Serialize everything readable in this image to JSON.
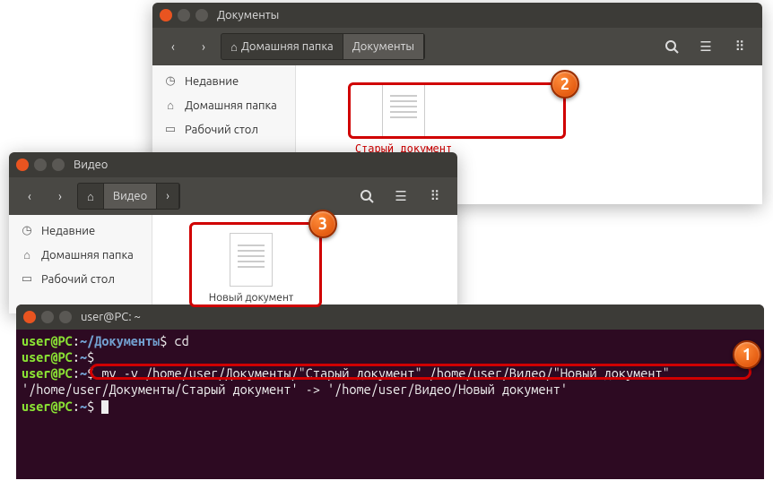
{
  "window1": {
    "title": "Документы",
    "breadcrumb": {
      "home_label": "Домашняя папка",
      "current": "Документы"
    },
    "sidebar": {
      "recent": "Недавние",
      "home": "Домашняя папка",
      "desktop": "Рабочий стол"
    },
    "file": {
      "name": "Старый документ"
    }
  },
  "window2": {
    "title": "Видео",
    "breadcrumb": {
      "current": "Видео"
    },
    "sidebar": {
      "recent": "Недавние",
      "home": "Домашняя папка",
      "desktop": "Рабочий стол"
    },
    "file": {
      "name": "Новый документ"
    }
  },
  "terminal": {
    "title": "user@PC: ~",
    "lines": {
      "l1_user": "user@PC",
      "l1_colon": ":",
      "l1_path": "~/Документы",
      "l1_prompt": "$",
      "l1_cmd": "cd",
      "l2_user": "user@PC",
      "l2_path": "~",
      "l2_prompt": "$",
      "l3_user": "user@PC",
      "l3_path": "~",
      "l3_prompt": "$",
      "l3_cmd": "mv -v /home/user/Документы/\"Старый документ\" /home/user/Видео/\"Новый документ\"",
      "l4_out": "'/home/user/Документы/Старый документ' -> '/home/user/Видео/Новый документ'",
      "l5_user": "user@PC",
      "l5_path": "~",
      "l5_prompt": "$"
    }
  },
  "markers": {
    "m1": "1",
    "m2": "2",
    "m3": "3"
  }
}
